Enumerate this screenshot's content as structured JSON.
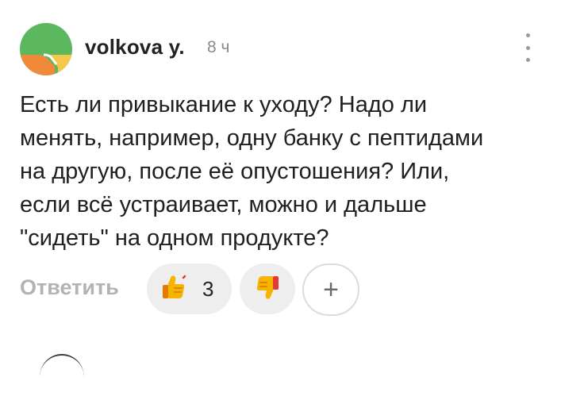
{
  "comment": {
    "author": "volkova y.",
    "time": "8 ч",
    "avatar_icon": "avatar-logo",
    "more_icon": "more-vertical-icon",
    "text_lines": [
      "Есть ли привыкание к уходу? Надо ли",
      "менять, например, одну банку с пептидами",
      "на другую, после её опустошения? Или,",
      "если всё устраивает, можно и дальше",
      "\"сидеть\" на одном продукте?"
    ]
  },
  "actions": {
    "reply_label": "Ответить",
    "like_icon": "thumbs-up-icon",
    "like_count": "3",
    "dislike_icon": "thumbs-down-icon",
    "add_reaction_icon": "plus-icon",
    "add_reaction_symbol": "+"
  },
  "colors": {
    "avatar_green": "#5cb85f",
    "avatar_orange": "#f08a3a",
    "avatar_yellow": "#f5c84a",
    "muted_text": "#b3b3b3",
    "pill_bg": "#eeeeee"
  }
}
